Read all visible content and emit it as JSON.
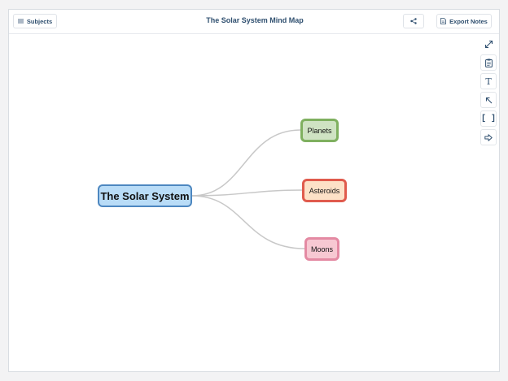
{
  "header": {
    "subjects_label": "Subjects",
    "title": "The Solar System Mind Map",
    "export_label": "Export Notes"
  },
  "toolbar": {
    "text_tool_glyph": "T",
    "bracket_tool_glyph": "[ ]"
  },
  "mindmap": {
    "root": "The Solar System",
    "branches": [
      {
        "label": "Planets",
        "fill": "#cfe3c3",
        "border": "#7fb060"
      },
      {
        "label": "Asteroids",
        "fill": "#fde1c7",
        "border": "#e05b4d"
      },
      {
        "label": "Moons",
        "fill": "#f7c8d2",
        "border": "#e48aa3"
      }
    ],
    "root_fill": "#b9dcf7",
    "root_border": "#4d87c0",
    "connector_color": "#c8c8c8"
  },
  "icons": {
    "subjects": "list-icon",
    "share": "share-icon",
    "export": "document-icon",
    "fullscreen": "expand-icon",
    "clipboard": "clipboard-icon",
    "text": "text-icon",
    "arrow": "arrow-up-left-icon",
    "brackets": "brackets-icon",
    "next": "arrow-right-icon"
  }
}
